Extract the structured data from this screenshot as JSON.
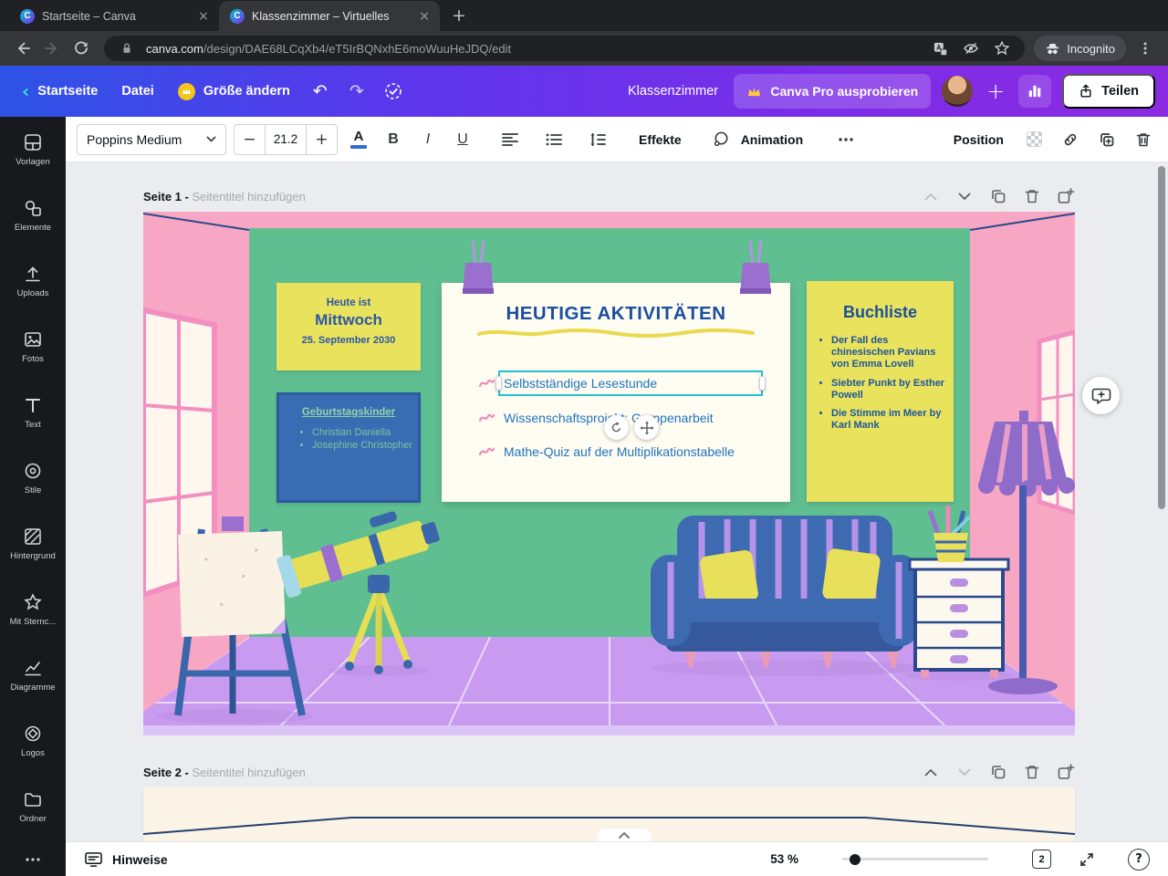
{
  "browser": {
    "tabs": [
      {
        "title": "Startseite – Canva"
      },
      {
        "title": "Klassenzimmer – Virtuelles"
      }
    ],
    "url": {
      "domain": "canva.com",
      "path": "/design/DAE68LCqXb4/eT5IrBQNxhE6moWuuHeJDQ/edit"
    },
    "incognito_label": "Incognito"
  },
  "header": {
    "back_label": "Startseite",
    "file_label": "Datei",
    "resize_label": "Größe ändern",
    "doc_title": "Klassenzimmer",
    "pro_label": "Canva Pro ausprobieren",
    "share_label": "Teilen"
  },
  "toolbar": {
    "font_name": "Poppins Medium",
    "font_size": "21.2",
    "minus_glyph": "−",
    "plus_glyph": "+",
    "color_letter": "A",
    "bold_letter": "B",
    "italic_letter": "I",
    "underline_letter": "U",
    "effects_label": "Effekte",
    "animation_label": "Animation",
    "position_label": "Position"
  },
  "icons": {
    "undo_glyph": "↶",
    "redo_glyph": "↷",
    "back_chevron": "‹",
    "close_glyph": "×",
    "newtab_glyph": "+",
    "header_plus_glyph": "+",
    "question_glyph": "?"
  },
  "sidebar": {
    "items": [
      {
        "label": "Vorlagen"
      },
      {
        "label": "Elemente"
      },
      {
        "label": "Uploads"
      },
      {
        "label": "Fotos"
      },
      {
        "label": "Text"
      },
      {
        "label": "Stile"
      },
      {
        "label": "Hintergrund"
      },
      {
        "label": "Mit Sternc..."
      },
      {
        "label": "Diagramme"
      },
      {
        "label": "Logos"
      },
      {
        "label": "Ordner"
      }
    ]
  },
  "canvas": {
    "page1_label": "Seite 1 -",
    "page1_sub": "Seitentitel hinzufügen",
    "page2_label": "Seite 2 -",
    "page2_sub": "Seitentitel hinzufügen"
  },
  "design": {
    "date_note": {
      "line1": "Heute ist",
      "line2": "Mittwoch",
      "line3": "25. September 2030"
    },
    "birthday_board": {
      "title": "Geburtstagskinder",
      "children": [
        "Christian Daniella",
        "Josephine Christopher"
      ]
    },
    "activities": {
      "title": "HEUTIGE AKTIVITÄTEN",
      "items": [
        "Selbstständige Lesestunde",
        "Wissenschaftsprojekt: Gruppenarbeit",
        "Mathe-Quiz auf der Multiplikationstabelle"
      ]
    },
    "booklist": {
      "title": "Buchliste",
      "books": [
        "Der Fall des chinesischen Pavians von Emma Lovell",
        "Siebter Punkt by Esther Powell",
        "Die Stimme im Meer by Karl Mank"
      ]
    }
  },
  "statusbar": {
    "notes_label": "Hinweise",
    "zoom_level": "53 %",
    "page_count": "2"
  },
  "colors": {
    "selection": "#1fc3cc",
    "wall_green": "#60bf90",
    "wall_pink": "#f7a7c3",
    "floor_purple": "#c99bf0",
    "note_yellow": "#e9e25c",
    "board_blue": "#3a6cb4",
    "text_blue": "#1b4f9e"
  }
}
